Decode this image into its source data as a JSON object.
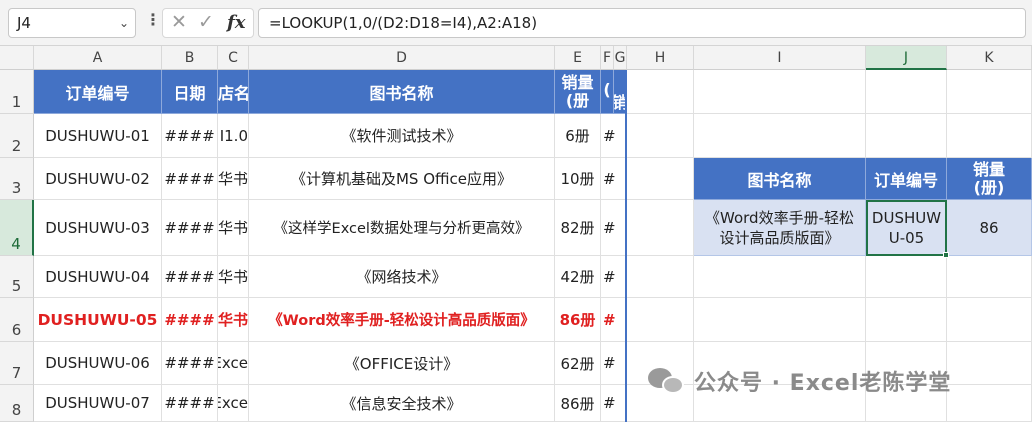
{
  "formula_bar": {
    "name_box": "J4",
    "formula": "=LOOKUP(1,0/(D2:D18=I4),A2:A18)"
  },
  "columns": [
    "A",
    "B",
    "C",
    "D",
    "E",
    "F",
    "G",
    "H",
    "I",
    "J",
    "K"
  ],
  "rows": [
    "1",
    "2",
    "3",
    "4",
    "5",
    "6",
    "7",
    "8"
  ],
  "table": {
    "headers": {
      "order_id": "订单编号",
      "date": "日期",
      "store": "店名",
      "book": "图书名称",
      "qty_line1": "销量",
      "qty_line2": "(册",
      "f_header": "(",
      "g_header": "销"
    },
    "rows": [
      {
        "order_id": "DUSHUWU-01",
        "date": "####",
        "store": "I1.0",
        "book": "《软件测试技术》",
        "qty": "6册",
        "f": "#"
      },
      {
        "order_id": "DUSHUWU-02",
        "date": "####",
        "store": "华书",
        "book": "《计算机基础及MS Office应用》",
        "qty": "10册",
        "f": "#"
      },
      {
        "order_id": "DUSHUWU-03",
        "date": "####",
        "store": "华书",
        "book": "《这样学Excel数据处理与分析更高效》",
        "qty": "82册",
        "f": "#"
      },
      {
        "order_id": "DUSHUWU-04",
        "date": "####",
        "store": "华书",
        "book": "《网络技术》",
        "qty": "42册",
        "f": "#"
      },
      {
        "order_id": "DUSHUWU-05",
        "date": "####",
        "store": "华书",
        "book": "《Word效率手册-轻松设计高品质版面》",
        "qty": "86册",
        "f": "#"
      },
      {
        "order_id": "DUSHUWU-06",
        "date": "####",
        "store": "Exce",
        "book": "《OFFICE设计》",
        "qty": "62册",
        "f": "#"
      },
      {
        "order_id": "DUSHUWU-07",
        "date": "####",
        "store": "Exce",
        "book": "《信息安全技术》",
        "qty": "86册",
        "f": "#"
      }
    ]
  },
  "lookup": {
    "headers": {
      "book": "图书名称",
      "order_id": "订单编号",
      "qty": "销量\n(册)"
    },
    "book": "《Word效率手册-轻松设计高品质版面》",
    "order_id": "DUSHUWU-05",
    "qty": "86"
  },
  "watermark": "公众号 · Excel老陈学堂",
  "colors": {
    "header_fill": "#4472c4",
    "lookup_fill": "#d9e1f2",
    "highlight_text": "#e02020",
    "selection": "#217346"
  }
}
